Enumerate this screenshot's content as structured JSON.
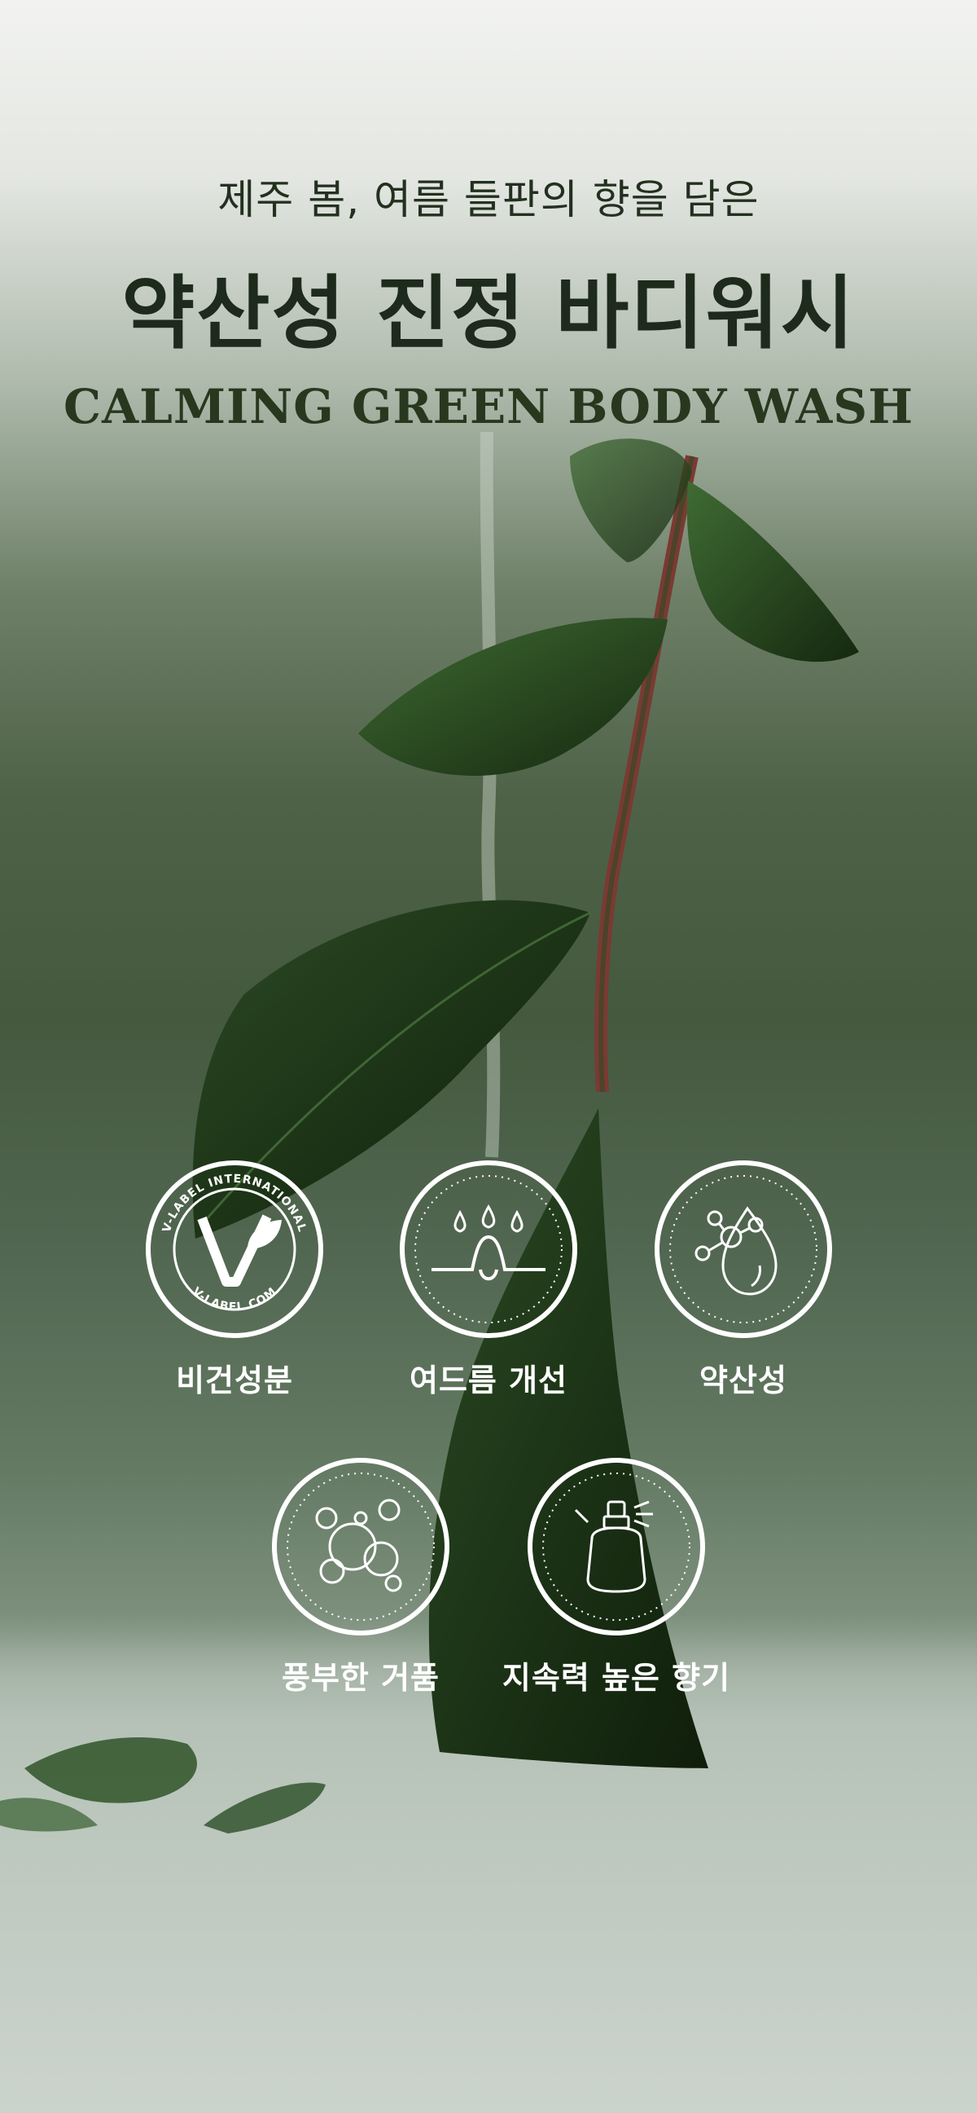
{
  "header": {
    "subtitle": "제주 봄, 여름 들판의 향을 담은",
    "title": "약산성 진정 바디워시",
    "english_title": "CALMING GREEN BODY WASH"
  },
  "badges": [
    {
      "icon": "vegan-label-icon",
      "label": "비건성분",
      "seal_top": "V-LABEL INTERNATIONAL",
      "seal_bottom": "V-LABEL.COM"
    },
    {
      "icon": "skin-drops-icon",
      "label": "여드름 개선"
    },
    {
      "icon": "molecule-drop-icon",
      "label": "약산성"
    },
    {
      "icon": "bubbles-icon",
      "label": "풍부한 거품"
    },
    {
      "icon": "perfume-bottle-icon",
      "label": "지속력 높은 향기"
    }
  ],
  "colors": {
    "title": "#1d2a1c",
    "badge_stroke": "#ffffff",
    "badge_label": "#ffffff"
  }
}
